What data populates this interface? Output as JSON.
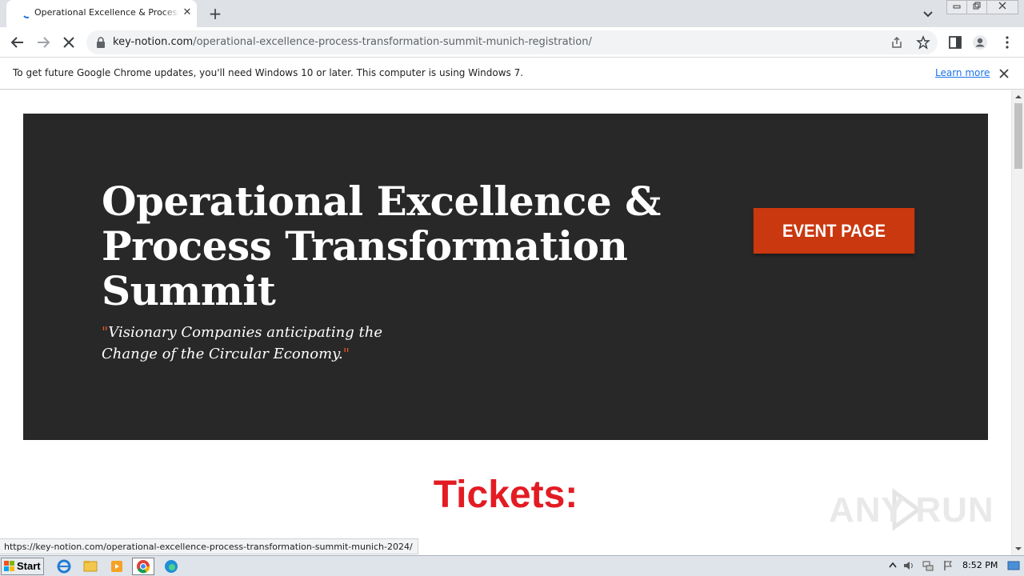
{
  "browser": {
    "tab": {
      "title": "Operational Excellence & Process Transformation Summit Munich Registration",
      "favicon": "loading-spinner-icon"
    },
    "window_controls": [
      "minimize",
      "restore",
      "close"
    ],
    "address_bar": {
      "host": "key-notion.com",
      "path": "/operational-excellence-process-transformation-summit-munich-registration/"
    },
    "info_bar": {
      "message": "To get future Google Chrome updates, you'll need Windows 10 or later. This computer is using Windows 7.",
      "link": "Learn more"
    },
    "status_url": "https://key-notion.com/operational-excellence-process-transformation-summit-munich-2024/"
  },
  "page": {
    "hero": {
      "title_lines": [
        "Operational Excellence &",
        "Process Transformation",
        "Summit"
      ],
      "quote_open": "\"",
      "quote_text": "Visionary Companies anticipating the Change of the Circular Economy.",
      "quote_close": "\"",
      "button": "EVENT PAGE",
      "background": "#282828",
      "button_color": "#c9380f",
      "quote_mark_color": "#e0542b"
    },
    "tickets_heading": "Tickets:",
    "tickets_color": "#e31b23",
    "watermark": "ANY RUN"
  },
  "taskbar": {
    "start_label": "Start",
    "apps": [
      "internet-explorer-icon",
      "file-explorer-icon",
      "media-player-icon",
      "chrome-icon",
      "edge-icon"
    ],
    "clock": "8:52 PM"
  }
}
